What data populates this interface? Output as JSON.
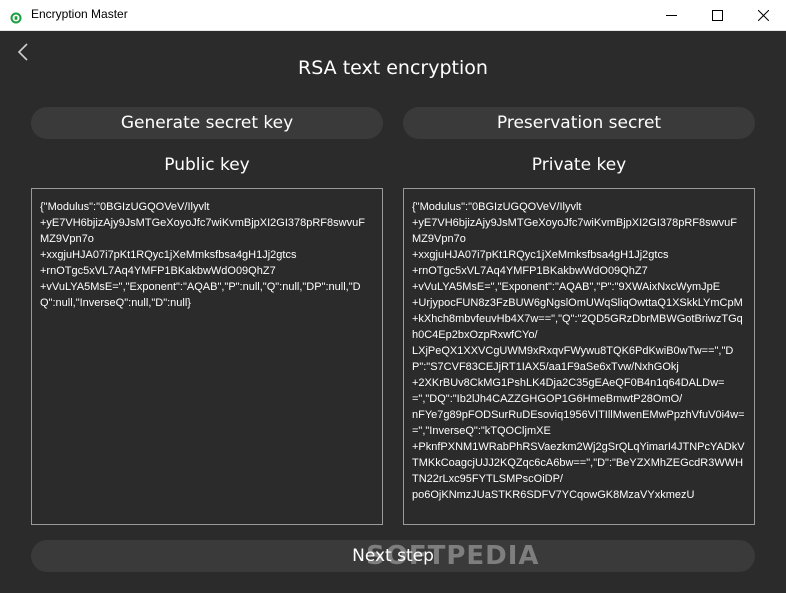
{
  "window": {
    "title": "Encryption Master"
  },
  "page": {
    "title": "RSA text encryption"
  },
  "buttons": {
    "generate": "Generate secret key",
    "preservation": "Preservation secret",
    "next": "Next step"
  },
  "labels": {
    "public_key": "Public key",
    "private_key": "Private key"
  },
  "public_key_text": "{\"Modulus\":\"0BGIzUGQOVeV/Ilyvlt\n+yE7VH6bjizAjy9JsMTGeXoyoJfc7wiKvmBjpXI2GI378pRF8swvuFMZ9Vpn7o\n+xxgjuHJA07i7pKt1RQyc1jXeMmksfbsa4gH1Jj2gtcs\n+rnOTgc5xVL7Aq4YMFP1BKakbwWdO09QhZ7\n+vVuLYA5MsE=\",\"Exponent\":\"AQAB\",\"P\":null,\"Q\":null,\"DP\":null,\"DQ\":null,\"InverseQ\":null,\"D\":null}",
  "private_key_text": "{\"Modulus\":\"0BGIzUGQOVeV/Ilyvlt\n+yE7VH6bjizAjy9JsMTGeXoyoJfc7wiKvmBjpXI2GI378pRF8swvuFMZ9Vpn7o\n+xxgjuHJA07i7pKt1RQyc1jXeMmksfbsa4gH1Jj2gtcs\n+rnOTgc5xVL7Aq4YMFP1BKakbwWdO09QhZ7\n+vVuLYA5MsE=\",\"Exponent\":\"AQAB\",\"P\":\"9XWAixNxcWymJpE\n+UrjypocFUN8z3FzBUW6gNgslOmUWqSliqOwttaQ1XSkkLYmCpM\n+kXhch8mbvfeuvHb4X7w==\",\"Q\":\"2QD5GRzDbrMBWGotBriwzTGqh0C4Ep2bxOzpRxwfCYo/\nLXjPeQX1XXVCgUWM9xRxqvFWywu8TQK6PdKwiB0wTw==\",\"DP\":\"S7CVF83CEJjRT1IAX5/aa1F9aSe6xTvw/NxhGOkj\n+2XKrBUv8CkMG1PshLK4Dja2C35gEAeQF0B4n1q64DALDw==\",\"DQ\":\"Ib2lJh4CAZZGHGOP1G6HmeBmwtP28OmO/\nnFYe7g89pFODSurRuDEsoviq1956VITIllMwenEMwPpzhVfuV0i4w==\",\"InverseQ\":\"kTQOCljmXE\n+PknfPXNM1WRabPhRSVaezkm2Wj2gSrQLqYimarI4JTNPcYADkVTMKkCoagcjUJJ2KQZqc6cA6bw==\",\"D\":\"BeYZXMhZEGcdR3WWHTN22rLxc95FYTLSMPscOiDP/\npo6OjKNmzJUaSTKR6SDFV7YCqowGK8MzaVYxkmezU",
  "watermark": "SOFTPEDIA",
  "icons": {
    "app": "lock-shield-icon",
    "back": "chevron-left-icon",
    "minimize": "minimize-icon",
    "maximize": "maximize-icon",
    "close": "close-icon"
  },
  "colors": {
    "background": "#2b2b2b",
    "pill": "#3a3a3a",
    "border": "#9a9a9a",
    "app_icon": "#1a9e3f"
  }
}
